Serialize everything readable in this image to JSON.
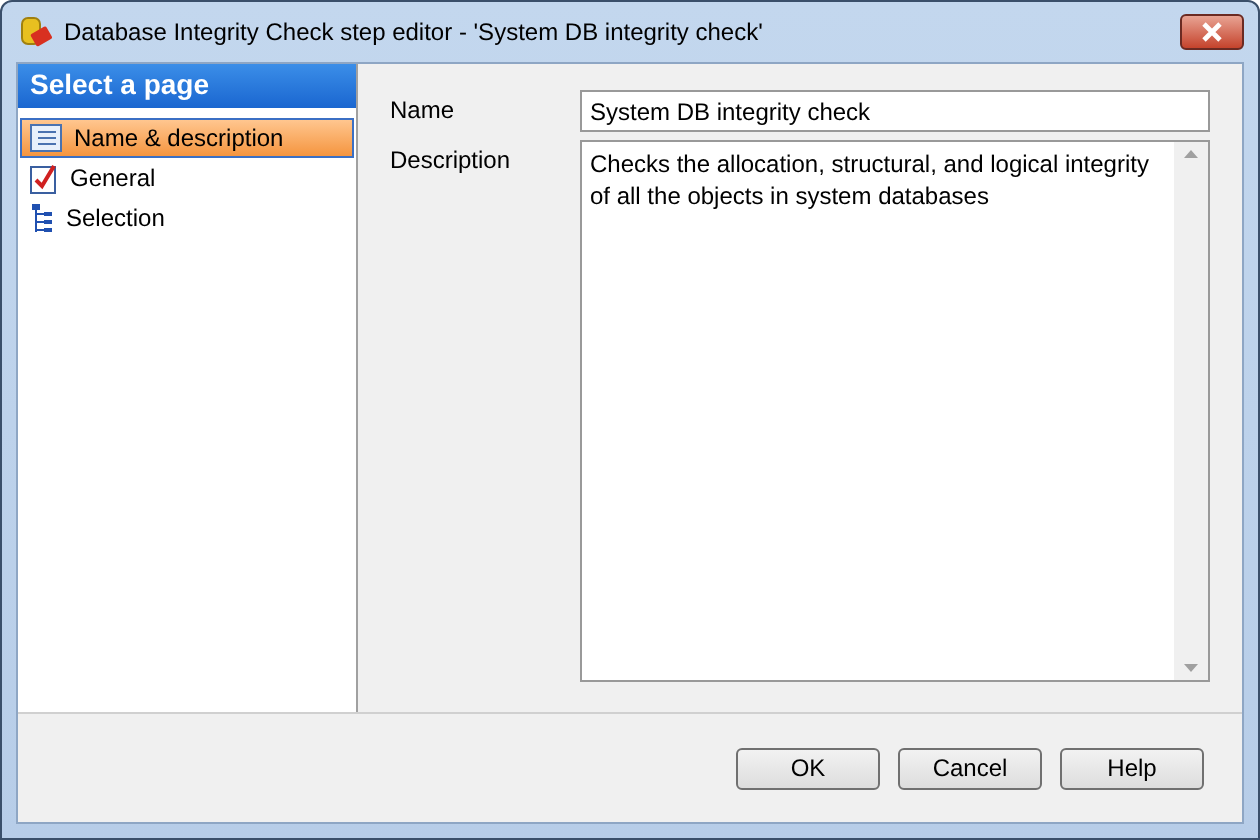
{
  "window": {
    "title": "Database Integrity Check step editor - 'System DB integrity check'"
  },
  "sidebar": {
    "header": "Select a page",
    "items": [
      {
        "label": "Name & description",
        "kind": "list",
        "selected": true
      },
      {
        "label": "General",
        "kind": "check",
        "selected": false
      },
      {
        "label": "Selection",
        "kind": "tree",
        "selected": false
      }
    ]
  },
  "form": {
    "name_label": "Name",
    "name_value": "System DB integrity check",
    "description_label": "Description",
    "description_value": "Checks the allocation, structural, and logical integrity of all the objects in system databases"
  },
  "buttons": [
    "OK",
    "Cancel",
    "Help"
  ]
}
